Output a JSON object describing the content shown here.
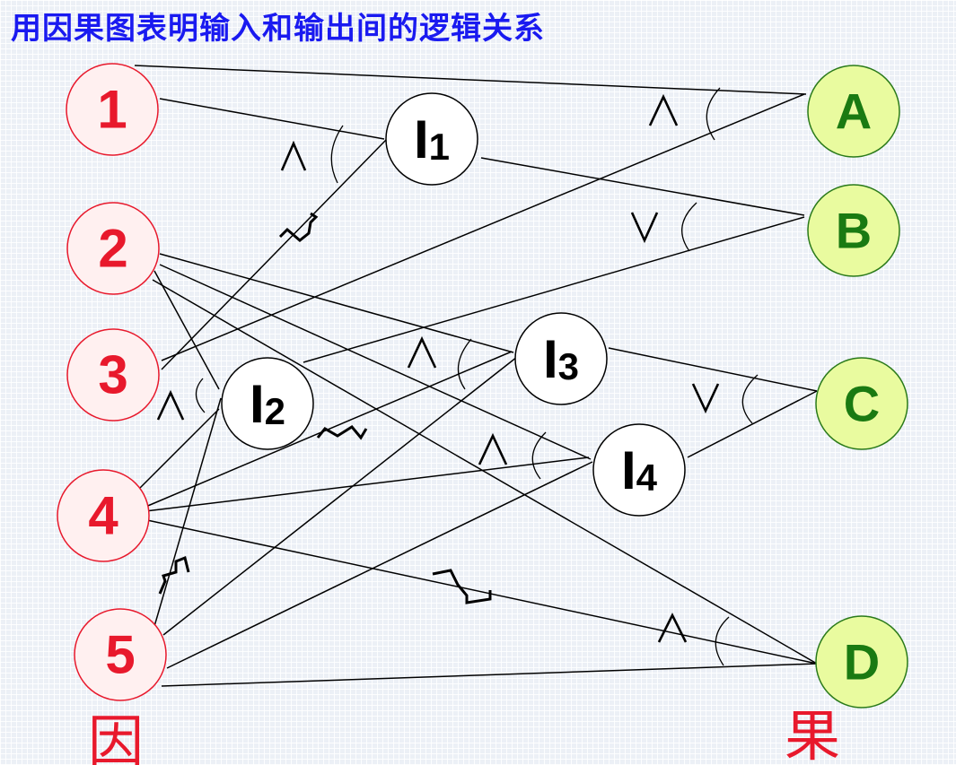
{
  "title": "用因果图表明输入和输出间的逻辑关系",
  "causes": [
    "1",
    "2",
    "3",
    "4",
    "5"
  ],
  "intermediates": [
    {
      "main": "I",
      "sub": "1"
    },
    {
      "main": "I",
      "sub": "2"
    },
    {
      "main": "I",
      "sub": "3"
    },
    {
      "main": "I",
      "sub": "4"
    }
  ],
  "effects": [
    "A",
    "B",
    "C",
    "D"
  ],
  "cause_label": "因",
  "effect_label": "果",
  "colors": {
    "cause": "#e8192c",
    "effect_fill": "#e9fb9f",
    "effect_text": "#1a7a12",
    "title": "#1a1af0"
  }
}
